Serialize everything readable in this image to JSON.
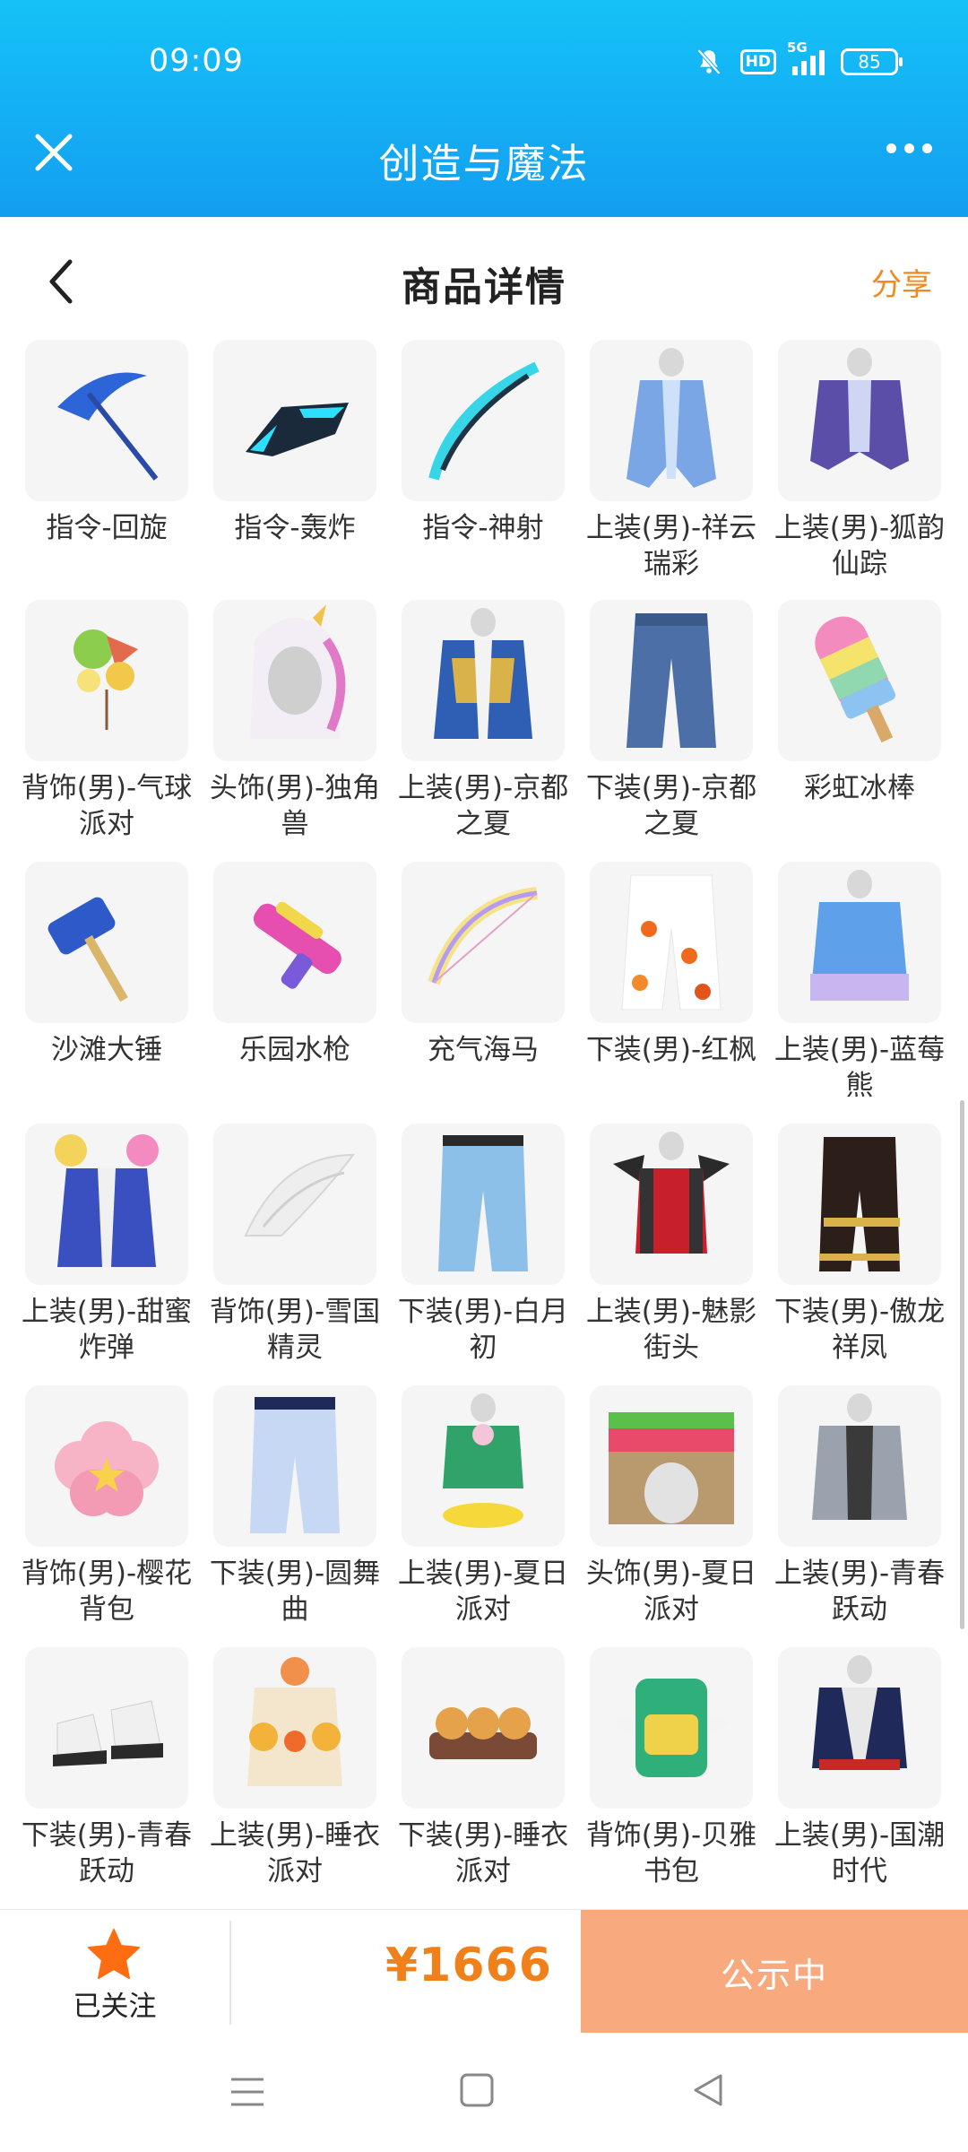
{
  "status_bar": {
    "time": "09:09",
    "network": "5G",
    "hd": "HD",
    "battery": "85"
  },
  "app_bar": {
    "title": "创造与魔法"
  },
  "page_header": {
    "title": "商品详情",
    "share": "分享"
  },
  "items": [
    {
      "name": "指令-回旋"
    },
    {
      "name": "指令-轰炸"
    },
    {
      "name": "指令-神射"
    },
    {
      "name": "上装(男)-祥云瑞彩"
    },
    {
      "name": "上装(男)-狐韵仙踪"
    },
    {
      "name": "背饰(男)-气球派对"
    },
    {
      "name": "头饰(男)-独角兽"
    },
    {
      "name": "上装(男)-京都之夏"
    },
    {
      "name": "下装(男)-京都之夏"
    },
    {
      "name": "彩虹冰棒"
    },
    {
      "name": "沙滩大锤"
    },
    {
      "name": "乐园水枪"
    },
    {
      "name": "充气海马"
    },
    {
      "name": "下装(男)-红枫"
    },
    {
      "name": "上装(男)-蓝莓熊"
    },
    {
      "name": "上装(男)-甜蜜炸弹"
    },
    {
      "name": "背饰(男)-雪国精灵"
    },
    {
      "name": "下装(男)-白月初"
    },
    {
      "name": "上装(男)-魅影街头"
    },
    {
      "name": "下装(男)-傲龙祥凤"
    },
    {
      "name": "背饰(男)-樱花背包"
    },
    {
      "name": "下装(男)-圆舞曲"
    },
    {
      "name": "上装(男)-夏日派对"
    },
    {
      "name": "头饰(男)-夏日派对"
    },
    {
      "name": "上装(男)-青春跃动"
    },
    {
      "name": "下装(男)-青春跃动"
    },
    {
      "name": "上装(男)-睡衣派对"
    },
    {
      "name": "下装(男)-睡衣派对"
    },
    {
      "name": "背饰(男)-贝雅书包"
    },
    {
      "name": "上装(男)-国潮时代"
    }
  ],
  "bottom_bar": {
    "follow_label": "已关注",
    "price": "¥1666",
    "status": "公示中"
  },
  "colors": {
    "header_blue": "#139ef1",
    "accent_orange": "#f0801a",
    "status_button": "#f8aa7e",
    "follow_star": "#ff6d12"
  }
}
